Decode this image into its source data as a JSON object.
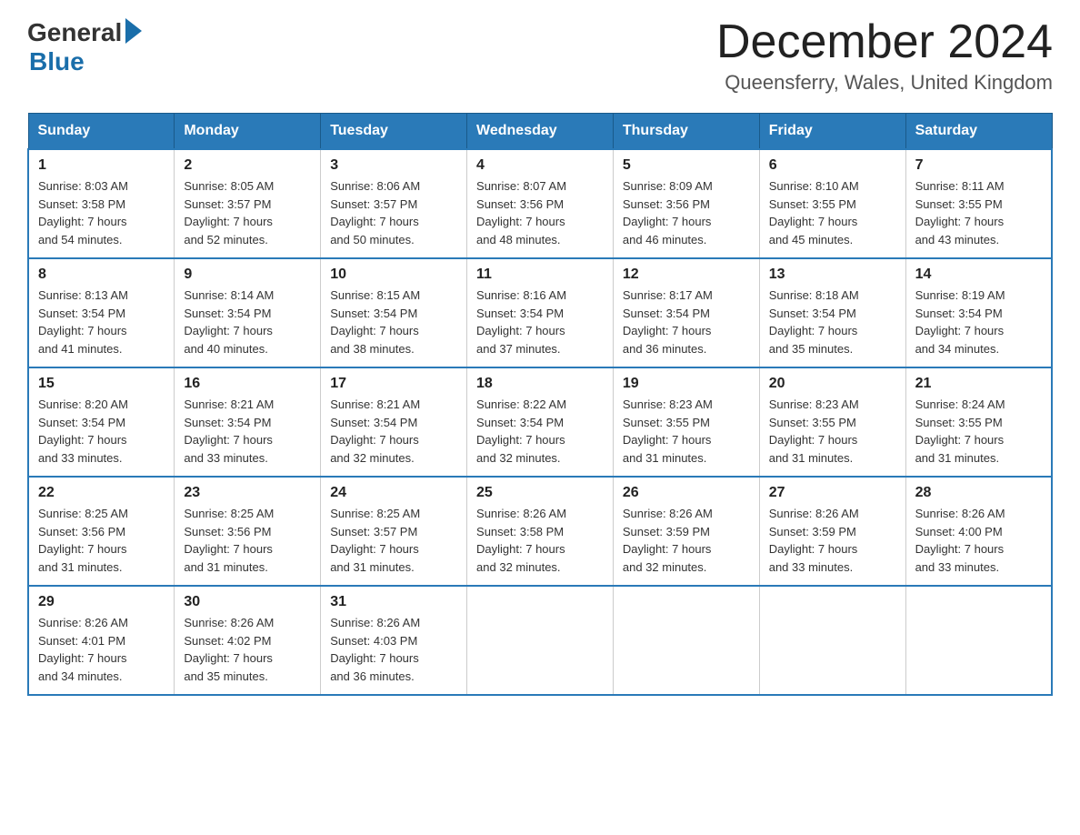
{
  "header": {
    "logo_general": "General",
    "logo_blue": "Blue",
    "title": "December 2024",
    "location": "Queensferry, Wales, United Kingdom"
  },
  "days_of_week": [
    "Sunday",
    "Monday",
    "Tuesday",
    "Wednesday",
    "Thursday",
    "Friday",
    "Saturday"
  ],
  "weeks": [
    [
      {
        "day": "1",
        "sunrise": "8:03 AM",
        "sunset": "3:58 PM",
        "daylight": "7 hours and 54 minutes."
      },
      {
        "day": "2",
        "sunrise": "8:05 AM",
        "sunset": "3:57 PM",
        "daylight": "7 hours and 52 minutes."
      },
      {
        "day": "3",
        "sunrise": "8:06 AM",
        "sunset": "3:57 PM",
        "daylight": "7 hours and 50 minutes."
      },
      {
        "day": "4",
        "sunrise": "8:07 AM",
        "sunset": "3:56 PM",
        "daylight": "7 hours and 48 minutes."
      },
      {
        "day": "5",
        "sunrise": "8:09 AM",
        "sunset": "3:56 PM",
        "daylight": "7 hours and 46 minutes."
      },
      {
        "day": "6",
        "sunrise": "8:10 AM",
        "sunset": "3:55 PM",
        "daylight": "7 hours and 45 minutes."
      },
      {
        "day": "7",
        "sunrise": "8:11 AM",
        "sunset": "3:55 PM",
        "daylight": "7 hours and 43 minutes."
      }
    ],
    [
      {
        "day": "8",
        "sunrise": "8:13 AM",
        "sunset": "3:54 PM",
        "daylight": "7 hours and 41 minutes."
      },
      {
        "day": "9",
        "sunrise": "8:14 AM",
        "sunset": "3:54 PM",
        "daylight": "7 hours and 40 minutes."
      },
      {
        "day": "10",
        "sunrise": "8:15 AM",
        "sunset": "3:54 PM",
        "daylight": "7 hours and 38 minutes."
      },
      {
        "day": "11",
        "sunrise": "8:16 AM",
        "sunset": "3:54 PM",
        "daylight": "7 hours and 37 minutes."
      },
      {
        "day": "12",
        "sunrise": "8:17 AM",
        "sunset": "3:54 PM",
        "daylight": "7 hours and 36 minutes."
      },
      {
        "day": "13",
        "sunrise": "8:18 AM",
        "sunset": "3:54 PM",
        "daylight": "7 hours and 35 minutes."
      },
      {
        "day": "14",
        "sunrise": "8:19 AM",
        "sunset": "3:54 PM",
        "daylight": "7 hours and 34 minutes."
      }
    ],
    [
      {
        "day": "15",
        "sunrise": "8:20 AM",
        "sunset": "3:54 PM",
        "daylight": "7 hours and 33 minutes."
      },
      {
        "day": "16",
        "sunrise": "8:21 AM",
        "sunset": "3:54 PM",
        "daylight": "7 hours and 33 minutes."
      },
      {
        "day": "17",
        "sunrise": "8:21 AM",
        "sunset": "3:54 PM",
        "daylight": "7 hours and 32 minutes."
      },
      {
        "day": "18",
        "sunrise": "8:22 AM",
        "sunset": "3:54 PM",
        "daylight": "7 hours and 32 minutes."
      },
      {
        "day": "19",
        "sunrise": "8:23 AM",
        "sunset": "3:55 PM",
        "daylight": "7 hours and 31 minutes."
      },
      {
        "day": "20",
        "sunrise": "8:23 AM",
        "sunset": "3:55 PM",
        "daylight": "7 hours and 31 minutes."
      },
      {
        "day": "21",
        "sunrise": "8:24 AM",
        "sunset": "3:55 PM",
        "daylight": "7 hours and 31 minutes."
      }
    ],
    [
      {
        "day": "22",
        "sunrise": "8:25 AM",
        "sunset": "3:56 PM",
        "daylight": "7 hours and 31 minutes."
      },
      {
        "day": "23",
        "sunrise": "8:25 AM",
        "sunset": "3:56 PM",
        "daylight": "7 hours and 31 minutes."
      },
      {
        "day": "24",
        "sunrise": "8:25 AM",
        "sunset": "3:57 PM",
        "daylight": "7 hours and 31 minutes."
      },
      {
        "day": "25",
        "sunrise": "8:26 AM",
        "sunset": "3:58 PM",
        "daylight": "7 hours and 32 minutes."
      },
      {
        "day": "26",
        "sunrise": "8:26 AM",
        "sunset": "3:59 PM",
        "daylight": "7 hours and 32 minutes."
      },
      {
        "day": "27",
        "sunrise": "8:26 AM",
        "sunset": "3:59 PM",
        "daylight": "7 hours and 33 minutes."
      },
      {
        "day": "28",
        "sunrise": "8:26 AM",
        "sunset": "4:00 PM",
        "daylight": "7 hours and 33 minutes."
      }
    ],
    [
      {
        "day": "29",
        "sunrise": "8:26 AM",
        "sunset": "4:01 PM",
        "daylight": "7 hours and 34 minutes."
      },
      {
        "day": "30",
        "sunrise": "8:26 AM",
        "sunset": "4:02 PM",
        "daylight": "7 hours and 35 minutes."
      },
      {
        "day": "31",
        "sunrise": "8:26 AM",
        "sunset": "4:03 PM",
        "daylight": "7 hours and 36 minutes."
      },
      null,
      null,
      null,
      null
    ]
  ],
  "labels": {
    "sunrise": "Sunrise:",
    "sunset": "Sunset:",
    "daylight": "Daylight:"
  }
}
